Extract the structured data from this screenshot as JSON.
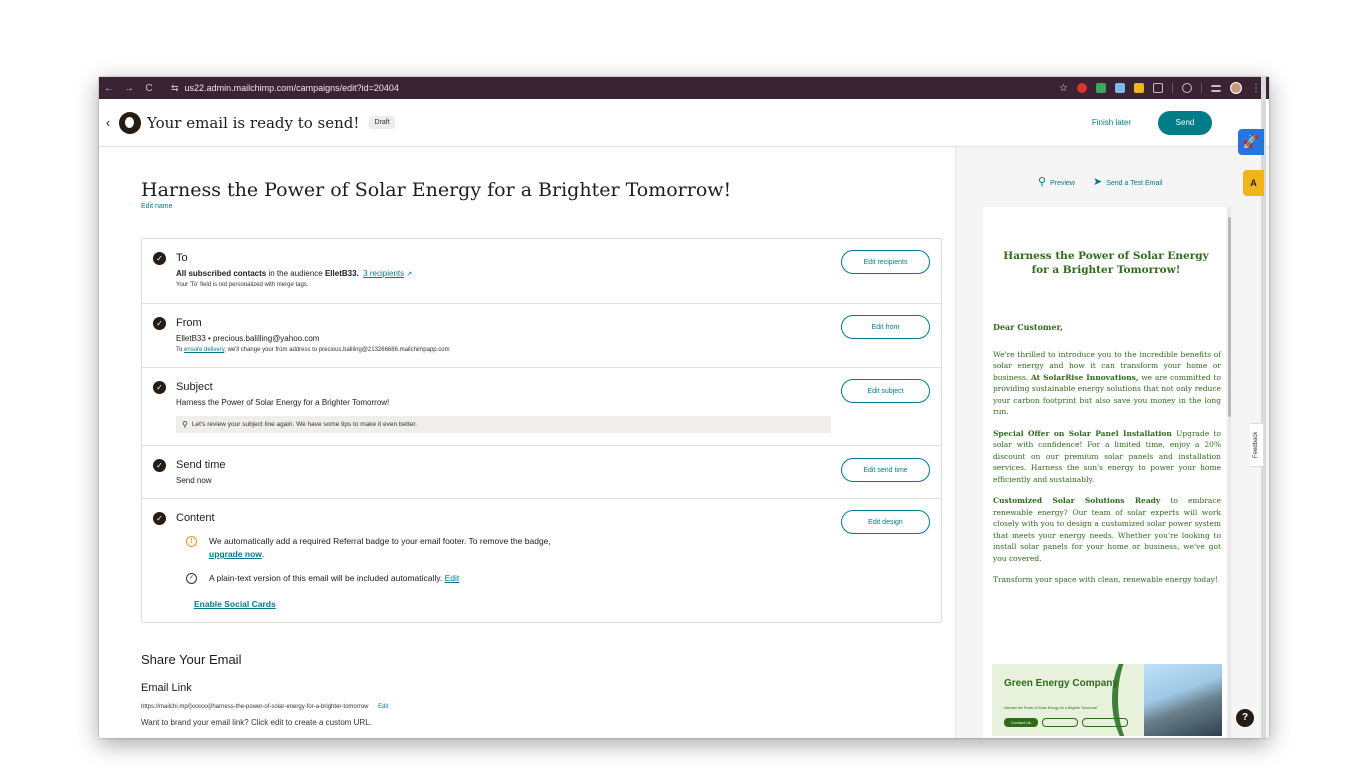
{
  "browser": {
    "url": "us22.admin.mailchimp.com/campaigns/edit?id=20404",
    "back": "←",
    "forward": "→",
    "reload": "C"
  },
  "header": {
    "title": "Your email is ready to send!",
    "badge": "Draft",
    "finish_later": "Finish later",
    "send": "Send"
  },
  "campaign": {
    "title": "Harness the Power of Solar Energy for a Brighter Tomorrow!",
    "edit_name": "Edit name"
  },
  "checklist": {
    "to": {
      "title": "To",
      "line_bold": "All subscribed contacts",
      "line_mid": " in the audience ",
      "audience": "ElletB33.",
      "recipients": "3 recipients",
      "note": "Your 'To' field is not personalized with merge tags.",
      "button": "Edit recipients"
    },
    "from": {
      "title": "From",
      "line": "ElletB33 • precious.balilling@yahoo.com",
      "note_pre": "To ",
      "note_link": "ensure delivery",
      "note_post": ", we'll change your from address to precious.baliling@213266686.mailchimpapp.com",
      "button": "Edit from"
    },
    "subject": {
      "title": "Subject",
      "line": "Harness the Power of Solar Energy for a Brighter Tomorrow!",
      "tip": "Let's review your subject line again. We have some tips to make it even better.",
      "button": "Edit subject"
    },
    "send_time": {
      "title": "Send time",
      "line": "Send now",
      "button": "Edit send time"
    },
    "content": {
      "title": "Content",
      "referral": "We automatically add a required Referral badge to your email footer. To remove the badge,",
      "upgrade": "upgrade now",
      "plain_text": "A plain-text version of this email will be included automatically.",
      "plain_edit": "Edit",
      "social_cards": "Enable Social Cards",
      "button": "Edit design"
    }
  },
  "share": {
    "title": "Share Your Email",
    "link_title": "Email Link",
    "url": "https://mailchi.mp/[xxxxxx]/harness-the-power-of-solar-energy-for-a-brighter-tomorrow",
    "edit": "Edit",
    "brand_text": "Want to brand your email link? Click edit to create a custom URL."
  },
  "preview": {
    "preview_label": "Preview",
    "test_label": "Send a Test Email",
    "heading": "Harness the Power of Solar Energy for a Brighter Tomorrow!",
    "greeting": "Dear Customer,",
    "p1_pre": "We're thrilled to introduce you to the incredible benefits of solar energy and how it can transform your home or business. ",
    "p1_bold": "At SolarRise Innovations,",
    "p1_post": " we are committed to providing sustainable energy solutions that not only reduce your carbon footprint but also save you money in the long run.",
    "p2_bold": "Special Offer on Solar Panel Installation",
    "p2_post": " Upgrade to solar with confidence! For a limited time, enjoy a 20% discount on our premium solar panels and installation services. Harness the sun's energy to power your home efficiently and sustainably.",
    "p3_bold": "Customized Solar Solutions Ready",
    "p3_post": " to embrace renewable energy? Our team of solar experts will work closely with you to design a customized solar power system that meets your energy needs. Whether you're looking to install solar panels for your home or business, we've got you covered.",
    "p4": "Transform your space with clean, renewable energy today!",
    "banner_title": "Green Energy Company",
    "banner_sub": "Harness the Power of Solar Energy for a Brighter Tomorrow!",
    "banner_btn": "Contact Us"
  },
  "widgets": {
    "feedback": "Feedback",
    "help": "?"
  },
  "colors": {
    "accent": "#007c89",
    "email_green": "#2f6b1a",
    "browser_bar": "#3a2434"
  }
}
